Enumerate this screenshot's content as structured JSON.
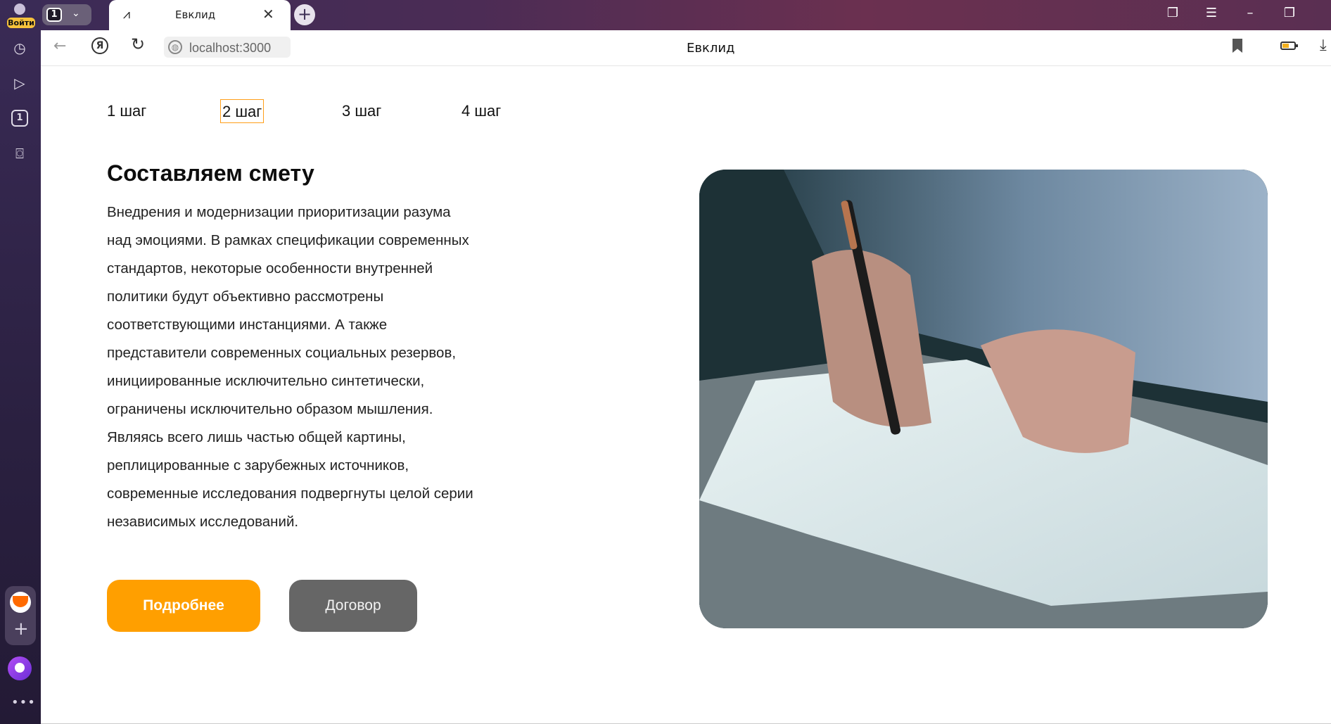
{
  "browser": {
    "login_label": "Войти",
    "tab_count": "1",
    "tab_title": "Евклид",
    "url": "localhost:3000",
    "page_title": "Евклид",
    "sidebar_counter": "1"
  },
  "steps": [
    {
      "label": "1 шаг",
      "active": false
    },
    {
      "label": "2 шаг",
      "active": true
    },
    {
      "label": "3 шаг",
      "active": false
    },
    {
      "label": "4 шаг",
      "active": false
    }
  ],
  "content": {
    "heading": "Составляем смету",
    "lines": [
      "Внедрения и модернизации приоритизации разума",
      "над эмоциями. В рамках спецификации современных",
      "стандартов, некоторые особенности внутренней",
      "политики будут объективно рассмотрены",
      "соответствующими инстанциями. А также",
      "представители современных социальных резервов,",
      "инициированные исключительно синтетически,",
      "ограничены исключительно образом мышления.",
      "Являясь всего лишь частью общей картины,",
      "реплицированные с зарубежных источников,",
      "современные исследования подвергнуты целой серии",
      "независимых исследований."
    ],
    "primary_button": "Подробнее",
    "secondary_button": "Договор"
  },
  "colors": {
    "accent": "#ff9f00",
    "secondary_button": "#666666",
    "active_step_border": "#ff9f1a"
  },
  "icons": [
    "back-arrow-icon",
    "yandex-icon",
    "reload-icon",
    "globe-icon",
    "bookmark-icon",
    "battery-icon",
    "download-icon",
    "history-icon",
    "play-icon",
    "screenshot-icon",
    "mail-icon",
    "plus-icon",
    "alice-icon",
    "more-icon"
  ]
}
